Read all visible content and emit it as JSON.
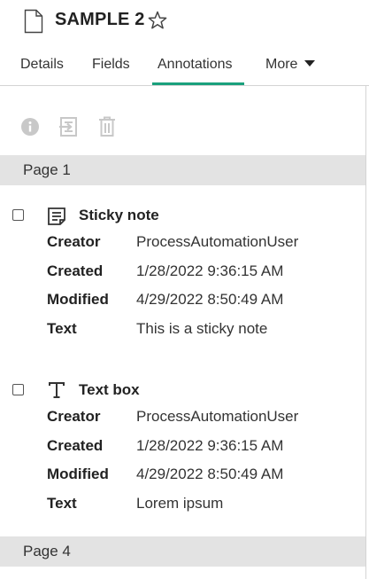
{
  "document": {
    "title": "SAMPLE 2",
    "icon": "document-icon",
    "favorite_icon": "star-outline-icon"
  },
  "tabs": [
    {
      "label": "Details",
      "active": false
    },
    {
      "label": "Fields",
      "active": false
    },
    {
      "label": "Annotations",
      "active": true
    },
    {
      "label": "More",
      "active": false,
      "icon": "caret-down-icon"
    }
  ],
  "colors": {
    "accent": "#1aa07c",
    "page_header_bg": "#e3e3e3",
    "toolbar_icon_disabled": "#c8c8c8"
  },
  "toolbar": {
    "items": [
      {
        "icon": "info-icon",
        "enabled": false
      },
      {
        "icon": "go-to-annotation-icon",
        "enabled": false
      },
      {
        "icon": "trash-icon",
        "enabled": false
      }
    ]
  },
  "pages": [
    {
      "label": "Page 1",
      "annotations": [
        {
          "icon": "sticky-note-icon",
          "title": "Sticky note",
          "checked": false,
          "properties": [
            {
              "label": "Creator",
              "value": "ProcessAutomationUser"
            },
            {
              "label": "Created",
              "value": "1/28/2022 9:36:15 AM"
            },
            {
              "label": "Modified",
              "value": "4/29/2022 8:50:49 AM"
            },
            {
              "label": "Text",
              "value": "This is a sticky note"
            }
          ]
        },
        {
          "icon": "text-box-icon",
          "title": "Text box",
          "checked": false,
          "properties": [
            {
              "label": "Creator",
              "value": "ProcessAutomationUser"
            },
            {
              "label": "Created",
              "value": "1/28/2022 9:36:15 AM"
            },
            {
              "label": "Modified",
              "value": "4/29/2022 8:50:49 AM"
            },
            {
              "label": "Text",
              "value": "Lorem ipsum"
            }
          ]
        }
      ]
    },
    {
      "label": "Page 4",
      "annotations": []
    }
  ]
}
